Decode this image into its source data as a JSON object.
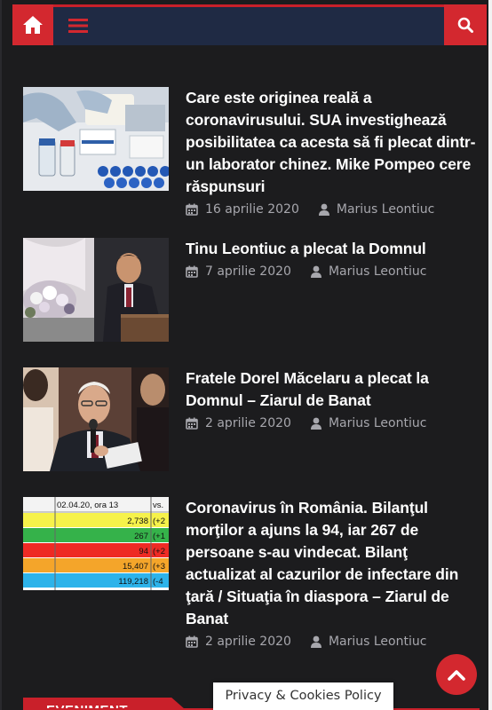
{
  "header": {
    "home_icon": "home-icon",
    "menu_icon": "hamburger-menu-icon",
    "search_icon": "search-icon",
    "accent_color": "#d3282f",
    "bar_color": "#1f2a44"
  },
  "articles": [
    {
      "title": "Care este originea reală a coronavirusului. SUA investighează posibilitatea ca acesta să fi plecat dintr-un laborator chinez. Mike Pompeo cere răspunsuri",
      "date": "16 aprilie 2020",
      "author": "Marius Leontiuc"
    },
    {
      "title": "Tinu Leontiuc a plecat la Domnul",
      "date": "7 aprilie 2020",
      "author": "Marius Leontiuc"
    },
    {
      "title": "Fratele Dorel Măcelaru a plecat la Domnul – Ziarul de Banat",
      "date": "2 aprilie 2020",
      "author": "Marius Leontiuc"
    },
    {
      "title": "Coronavirus în România. Bilanţul morţilor a ajuns la 94, iar 267 de persoane s-au vindecat. Bilanţ actualizat al cazurilor de infectare din ţară / Situaţia în diaspora – Ziarul de Banat",
      "date": "2 aprilie 2020",
      "author": "Marius Leontiuc",
      "thumb": {
        "header": "02.04.20, ora 13",
        "header_vs": "vs.",
        "rows": [
          "2,738",
          "267",
          "94",
          "15,407",
          "119,218"
        ],
        "deltas": [
          "(+2",
          "(+1",
          "(+2",
          "(+3",
          "(-4"
        ]
      }
    }
  ],
  "footer": {
    "privacy_label": "Privacy & Cookies Policy",
    "section_label": "EVENIMENT",
    "scroll_top_icon": "chevron-up-icon"
  }
}
